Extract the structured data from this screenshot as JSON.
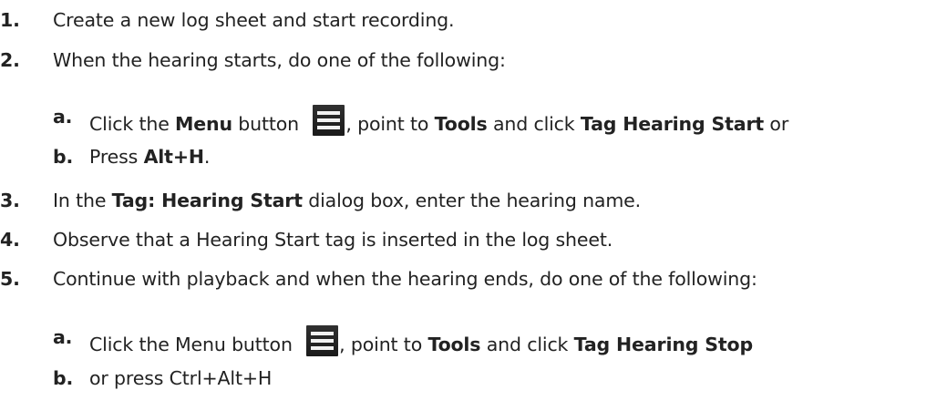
{
  "steps": [
    {
      "num": "1.",
      "text": "Create a new log sheet and start recording."
    },
    {
      "num": "2.",
      "text": "When the hearing starts, do one of the following:"
    },
    {
      "num": "3.",
      "pre": "In the ",
      "bold": "Tag: Hearing Start",
      "post": " dialog box, enter the hearing name."
    },
    {
      "num": "4.",
      "text": "Observe that a Hearing Start tag is inserted in the log sheet."
    },
    {
      "num": "5.",
      "text": "Continue with playback and when the hearing ends, do one of the following:"
    }
  ],
  "step2_sub": {
    "a": {
      "num": "a.",
      "t1": "Click the ",
      "b1": "Menu",
      "t2": " button ",
      "t3": ", point to ",
      "b2": "Tools",
      "t4": " and click ",
      "b3": "Tag Hearing Start",
      "t5": " or"
    },
    "b": {
      "num": "b.",
      "t1": "Press ",
      "b1": "Alt+H",
      "t2": "."
    }
  },
  "step5_sub": {
    "a": {
      "num": "a.",
      "t1": "Click the Menu button ",
      "t2": ", point to ",
      "b1": "Tools",
      "t3": " and click ",
      "b2": "Tag Hearing Stop"
    },
    "b": {
      "num": "b.",
      "t1": "or press Ctrl+Alt+H"
    }
  },
  "icons": {
    "menu": "hamburger-menu-icon"
  }
}
